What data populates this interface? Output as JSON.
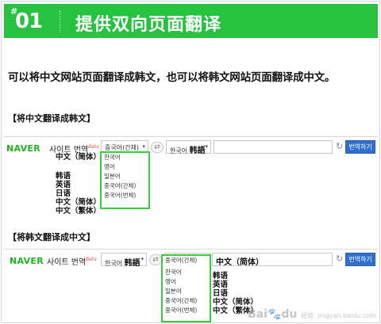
{
  "header": {
    "hash": "#",
    "number": "01",
    "title": "提供双向页面翻译"
  },
  "description": "可以将中文网站页面翻译成韩文，也可以将韩文网站页面翻译成中文。",
  "section1": {
    "label": "【将中文翻译成韩文】",
    "brand": "NAVER",
    "service": "사이트 번역",
    "beta": "Beta",
    "source_select": "중국어(간체)",
    "target_select": "한국어",
    "target_select_bold": "韩語",
    "url_value": "",
    "translate_button": "번역하기",
    "source_field": "中文（简体）",
    "dropdown_options": [
      "한국어",
      "영어",
      "일본어",
      "중국어(간체)",
      "중국어(번체)"
    ],
    "result_labels": [
      "韩语",
      "英语",
      "日语",
      "中文（简体）",
      "中文（繁体）"
    ]
  },
  "section2": {
    "label": "【将韩文翻译成中文】",
    "brand": "NAVER",
    "service": "사이트 번역",
    "beta": "Beta",
    "source_select": "한국어",
    "source_select_bold": "韩語",
    "target_select": "중국어(간체)",
    "url_value": "中文（简体）",
    "translate_button": "번역하기",
    "dropdown_options": [
      "한국어",
      "영어",
      "일본어",
      "중국어(간체)",
      "중국어(번체)"
    ],
    "result_labels": [
      "韩语",
      "英语",
      "日语",
      "中文（简体）",
      "中文（繁体）"
    ]
  },
  "watermark": {
    "main": "Bai",
    "paw": "du",
    "sub": "经验",
    "url": "jingyan.baidu.com"
  },
  "colors": {
    "banner": "#27c23f",
    "highlight": "#37cc3c",
    "button": "#2f6fcf",
    "naver": "#1fb41f"
  }
}
